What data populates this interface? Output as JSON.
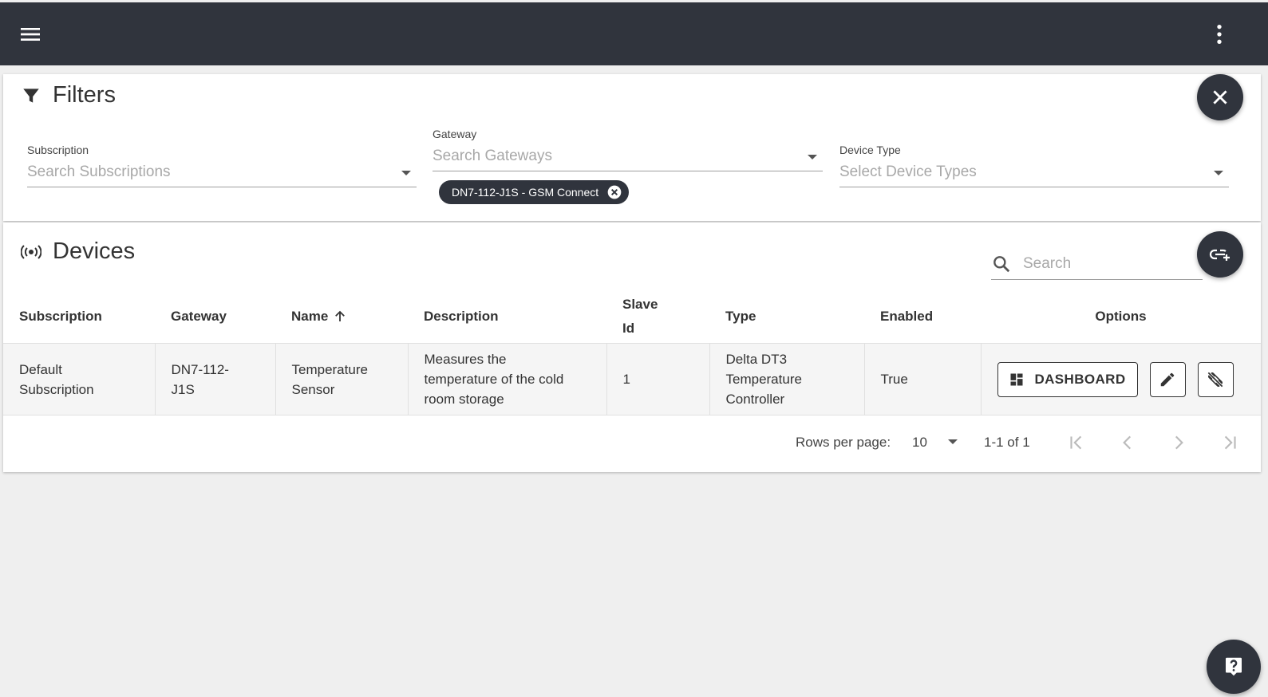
{
  "filters": {
    "title": "Filters",
    "subscription": {
      "label": "Subscription",
      "placeholder": "Search Subscriptions"
    },
    "gateway": {
      "label": "Gateway",
      "placeholder": "Search Gateways",
      "chip": "DN7-112-J1S - GSM Connect"
    },
    "device_type": {
      "label": "Device Type",
      "placeholder": "Select Device Types"
    }
  },
  "devices": {
    "title": "Devices",
    "search_placeholder": "Search",
    "columns": {
      "subscription": "Subscription",
      "gateway": "Gateway",
      "name": "Name",
      "description": "Description",
      "slave_id_1": "Slave",
      "slave_id_2": "Id",
      "type": "Type",
      "enabled": "Enabled",
      "options": "Options"
    },
    "rows": [
      {
        "subscription_1": "Default",
        "subscription_2": "Subscription",
        "gateway_1": "DN7-112-",
        "gateway_2": "J1S",
        "name_1": "Temperature",
        "name_2": "Sensor",
        "description_1": "Measures the",
        "description_2": "temperature of the cold",
        "description_3": "room storage",
        "slave_id": "1",
        "type_1": "Delta DT3",
        "type_2": "Temperature",
        "type_3": "Controller",
        "enabled": "True",
        "dashboard_label": "DASHBOARD"
      }
    ]
  },
  "pagination": {
    "rows_per_page_label": "Rows per page:",
    "rows_per_page": "10",
    "range": "1-1 of 1"
  },
  "colors": {
    "topbar": "#30343d",
    "background": "#efefef",
    "row": "#f5f5f5"
  }
}
